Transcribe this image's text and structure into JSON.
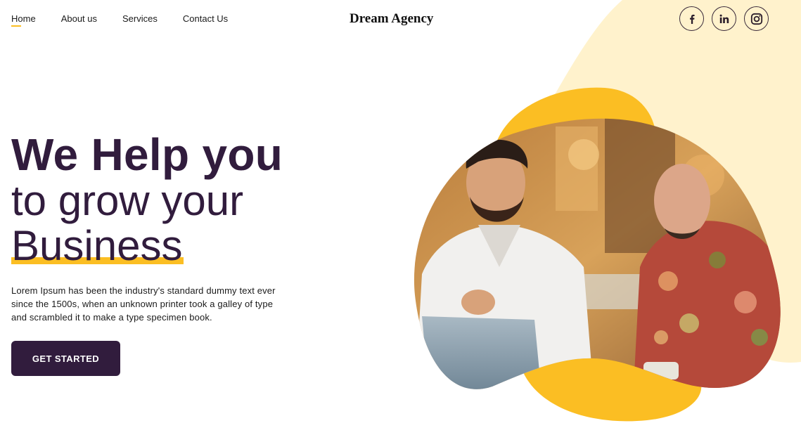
{
  "nav": {
    "items": [
      {
        "label": "Home",
        "active": true
      },
      {
        "label": "About us"
      },
      {
        "label": "Services"
      },
      {
        "label": "Contact Us"
      }
    ]
  },
  "brand": {
    "name": "Dream Agency"
  },
  "social": [
    {
      "icon": "facebook-icon"
    },
    {
      "icon": "linkedin-icon"
    },
    {
      "icon": "instagram-icon"
    }
  ],
  "hero": {
    "line1": "We Help you",
    "line2": "to grow your",
    "line3": "Business",
    "description": "Lorem Ipsum has been the industry's standard dummy text ever since the 1500s, when an unknown printer took a galley of type and scrambled it to make a type specimen book.",
    "cta_label": "GET STARTED"
  },
  "colors": {
    "primary": "#311c3d",
    "accent": "#fbbe23",
    "accent_light": "#fff2cc",
    "background": "#ffffff"
  }
}
